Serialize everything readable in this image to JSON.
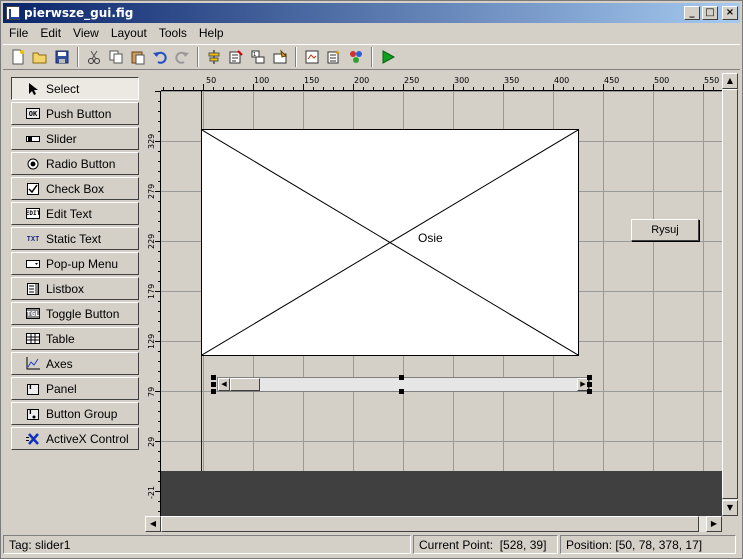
{
  "window": {
    "title": "pierwsze_gui.fig",
    "controls": [
      "_",
      "□",
      "×"
    ]
  },
  "menubar": {
    "items": [
      "File",
      "Edit",
      "View",
      "Layout",
      "Tools",
      "Help"
    ]
  },
  "toolbar": {
    "icons": [
      "new-file-icon",
      "open-folder-icon",
      "save-icon",
      "cut-icon",
      "copy-icon",
      "paste-icon",
      "undo-icon",
      "redo-icon",
      "align-icon",
      "menu-editor-icon",
      "tab-order-icon",
      "toolbar-editor-icon",
      "mfile-editor-icon",
      "property-inspector-icon",
      "object-browser-icon",
      "run-icon"
    ]
  },
  "palette": {
    "items": [
      {
        "label": "Select",
        "icon": "arrow-cursor-icon",
        "glyph": "➤"
      },
      {
        "label": "Push Button",
        "icon": "push-button-icon",
        "glyph": "OK"
      },
      {
        "label": "Slider",
        "icon": "slider-icon",
        "glyph": "▭"
      },
      {
        "label": "Radio Button",
        "icon": "radio-button-icon",
        "glyph": "◉"
      },
      {
        "label": "Check Box",
        "icon": "check-box-icon",
        "glyph": "☑"
      },
      {
        "label": "Edit Text",
        "icon": "edit-text-icon",
        "glyph": "EDIT"
      },
      {
        "label": "Static Text",
        "icon": "static-text-icon",
        "glyph": "TXT"
      },
      {
        "label": "Pop-up Menu",
        "icon": "popup-menu-icon",
        "glyph": "▭▾"
      },
      {
        "label": "Listbox",
        "icon": "listbox-icon",
        "glyph": "☰"
      },
      {
        "label": "Toggle Button",
        "icon": "toggle-button-icon",
        "glyph": "TGL"
      },
      {
        "label": "Table",
        "icon": "table-icon",
        "glyph": "▦"
      },
      {
        "label": "Axes",
        "icon": "axes-icon",
        "glyph": "📈"
      },
      {
        "label": "Panel",
        "icon": "panel-icon",
        "glyph": "T"
      },
      {
        "label": "Button Group",
        "icon": "button-group-icon",
        "glyph": "T"
      },
      {
        "label": "ActiveX Control",
        "icon": "activex-icon",
        "glyph": "✘"
      }
    ]
  },
  "rulers": {
    "horizontal": [
      "50",
      "100",
      "150",
      "200",
      "250",
      "300",
      "350",
      "400",
      "450",
      "500",
      "550"
    ],
    "vertical": [
      "329",
      "279",
      "229",
      "179",
      "129",
      "79",
      "29",
      "-21"
    ]
  },
  "layout_canvas": {
    "axes_label": "Osie",
    "button_label": "Rysuj"
  },
  "statusbar": {
    "tag": "Tag: slider1",
    "current_point": "Current Point:  [528, 39]",
    "position": "Position: [50, 78, 378, 17]"
  }
}
